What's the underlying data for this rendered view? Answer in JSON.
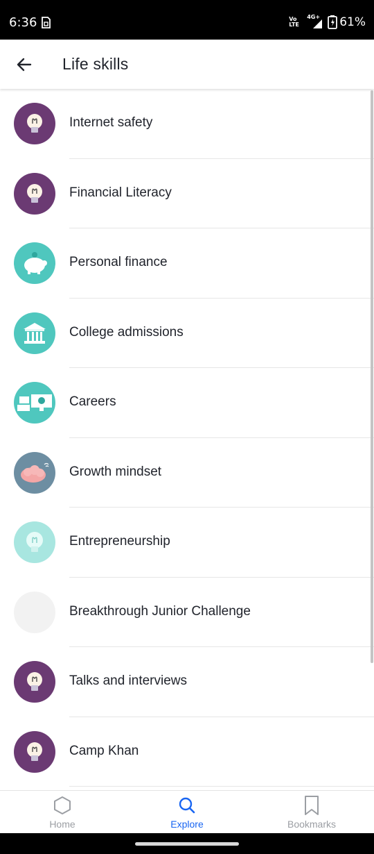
{
  "status_bar": {
    "time": "6:36",
    "volte": "Vo LTE",
    "network": "4G+",
    "battery": "61%"
  },
  "header": {
    "title": "Life skills",
    "back_icon": "arrow-left-icon"
  },
  "list": {
    "items": [
      {
        "label": "Internet safety",
        "icon": "lightbulb-icon",
        "bg": "#6b3a73"
      },
      {
        "label": "Financial Literacy",
        "icon": "lightbulb-icon",
        "bg": "#6b3a73"
      },
      {
        "label": "Personal finance",
        "icon": "piggy-bank-icon",
        "bg": "#4fc7be"
      },
      {
        "label": "College admissions",
        "icon": "college-building-icon",
        "bg": "#4fc7be"
      },
      {
        "label": "Careers",
        "icon": "careers-screens-icon",
        "bg": "#4fc7be"
      },
      {
        "label": "Growth mindset",
        "icon": "brain-icon",
        "bg": "#6d8ea2"
      },
      {
        "label": "Entrepreneurship",
        "icon": "lightbulb-icon",
        "bg": "#a8e6e0"
      },
      {
        "label": "Breakthrough Junior Challenge",
        "icon": "blank-icon",
        "bg": "#f2f2f2"
      },
      {
        "label": "Talks and interviews",
        "icon": "lightbulb-icon",
        "bg": "#6b3a73"
      },
      {
        "label": "Camp Khan",
        "icon": "lightbulb-icon",
        "bg": "#6b3a73"
      }
    ]
  },
  "bottom_nav": {
    "tabs": [
      {
        "label": "Home",
        "icon": "hexagon-home-icon",
        "active": false
      },
      {
        "label": "Explore",
        "icon": "search-icon",
        "active": true
      },
      {
        "label": "Bookmarks",
        "icon": "bookmark-icon",
        "active": false
      }
    ]
  },
  "colors": {
    "accent": "#1865f2",
    "inactive": "#9b9ea3",
    "purple": "#6b3a73",
    "teal": "#4fc7be"
  }
}
